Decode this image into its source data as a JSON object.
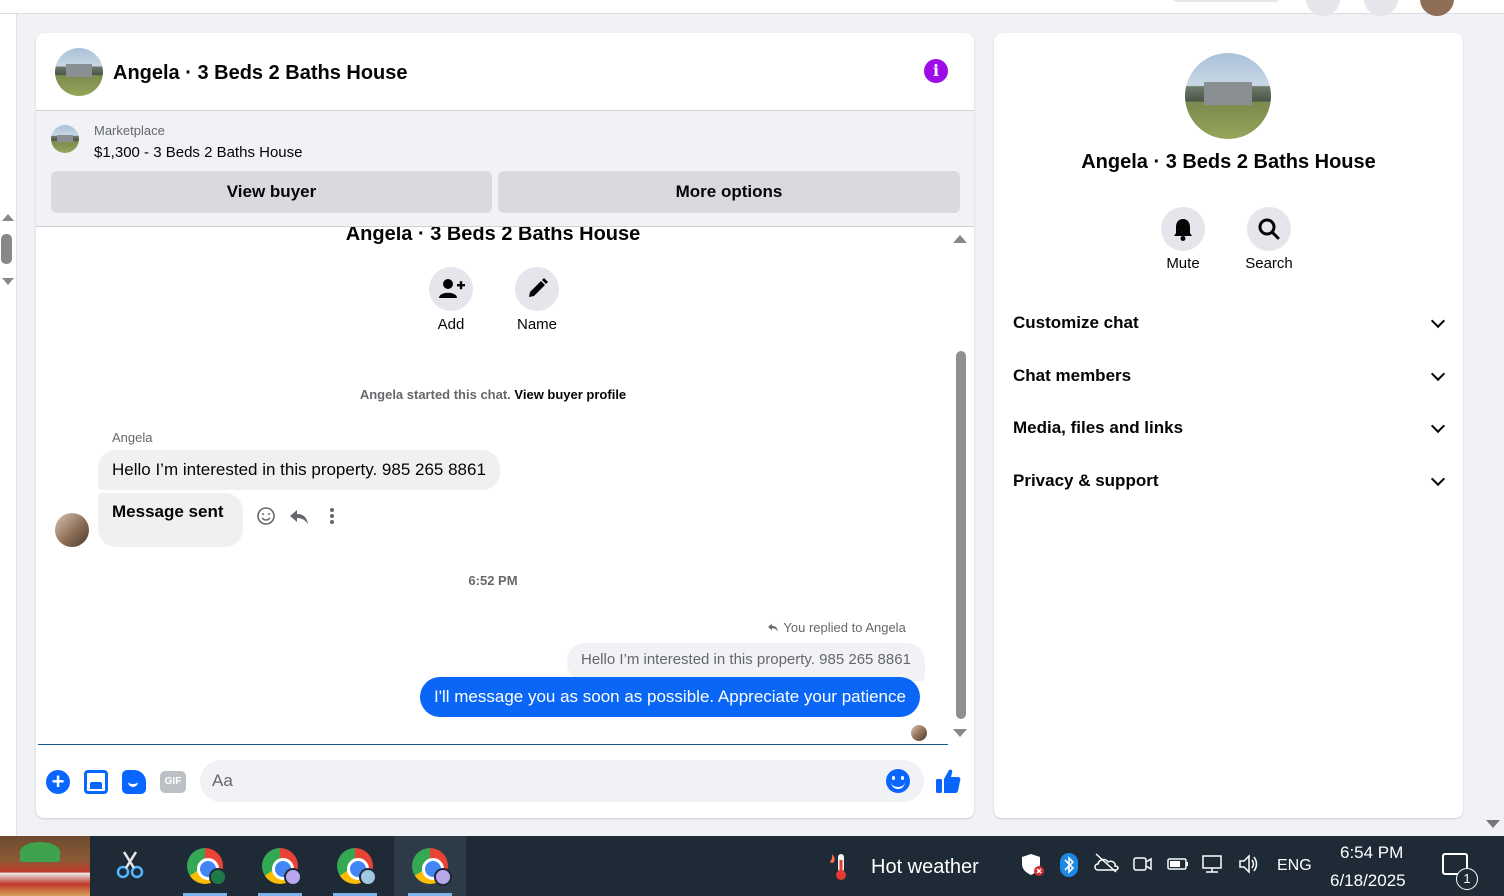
{
  "chat": {
    "title": "Angela · 3 Beds 2 Baths House",
    "listing": {
      "source": "Marketplace",
      "title": "$1,300 - 3 Beds 2 Baths House",
      "view_buyer": "View buyer",
      "more_options": "More options"
    },
    "thread": {
      "name": "Angela · 3 Beds 2 Baths House",
      "actions": [
        {
          "label": "Add",
          "icon": "person-add-icon"
        },
        {
          "label": "Name",
          "icon": "pencil-icon"
        }
      ],
      "started_prefix": "Angela started this chat.",
      "started_link": "View buyer profile",
      "sender": "Angela",
      "messages_in": [
        "Hello I’m interested in this property. 985 265 8861",
        "Message sent"
      ],
      "timestamp": "6:52 PM",
      "replied_label": "You replied to Angela",
      "quoted": "Hello I’m interested in this property. 985 265 8861",
      "message_out": "I'll message you as soon as possible. Appreciate your patience"
    },
    "composer": {
      "placeholder": "Aa",
      "gif_label": "GIF"
    }
  },
  "side": {
    "title": "Angela · 3 Beds 2 Baths House",
    "actions": [
      {
        "label": "Mute",
        "icon": "bell-icon"
      },
      {
        "label": "Search",
        "icon": "search-icon"
      }
    ],
    "sections": [
      "Customize chat",
      "Chat members",
      "Media, files and links",
      "Privacy & support"
    ]
  },
  "taskbar": {
    "weather": "Hot weather",
    "language": "ENG",
    "time": "6:54 PM",
    "date": "6/18/2025",
    "notification_count": "1"
  },
  "colors": {
    "accent_blue": "#0866ff",
    "outgoing_bubble": "#0a66f6",
    "info_purple": "#9d0ce8",
    "taskbar": "#1e2a36"
  }
}
